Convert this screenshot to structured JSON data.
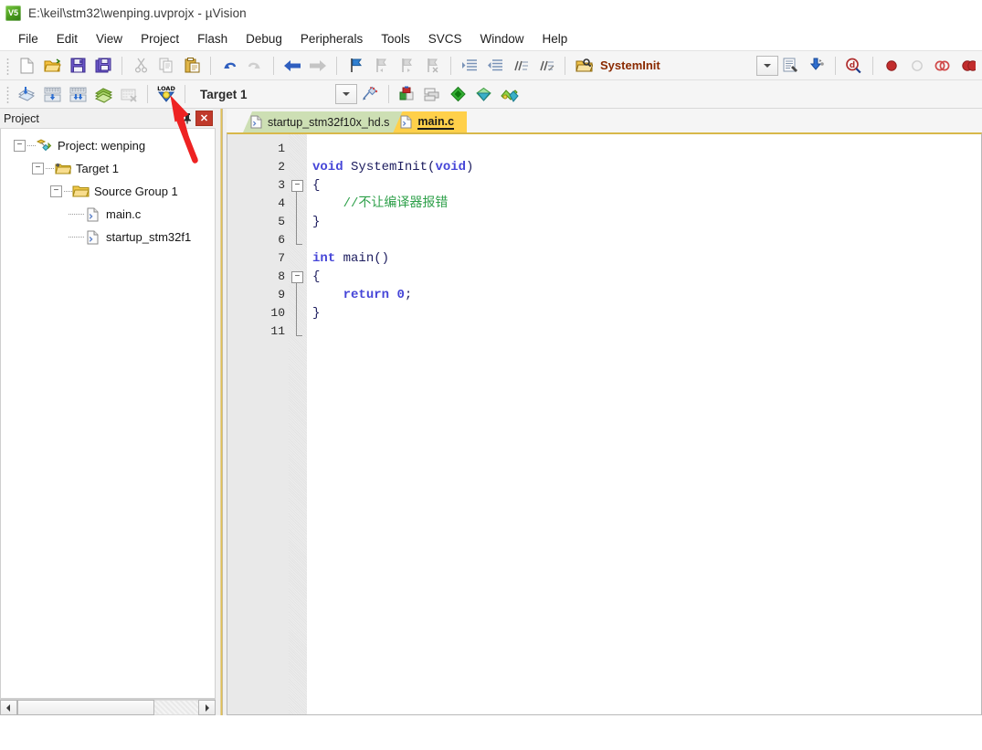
{
  "window": {
    "icon": "keil-uvision-icon",
    "icon_text": "V5",
    "title": "E:\\keil\\stm32\\wenping.uvprojx - µVision"
  },
  "menubar": {
    "items": [
      {
        "label": "File",
        "name": "menu-file"
      },
      {
        "label": "Edit",
        "name": "menu-edit"
      },
      {
        "label": "View",
        "name": "menu-view"
      },
      {
        "label": "Project",
        "name": "menu-project"
      },
      {
        "label": "Flash",
        "name": "menu-flash"
      },
      {
        "label": "Debug",
        "name": "menu-debug"
      },
      {
        "label": "Peripherals",
        "name": "menu-peripherals"
      },
      {
        "label": "Tools",
        "name": "menu-tools"
      },
      {
        "label": "SVCS",
        "name": "menu-svcs"
      },
      {
        "label": "Window",
        "name": "menu-window"
      },
      {
        "label": "Help",
        "name": "menu-help"
      }
    ]
  },
  "toolbar_main": {
    "buttons": [
      {
        "name": "new-file-icon",
        "title": "New"
      },
      {
        "name": "open-file-icon",
        "title": "Open"
      },
      {
        "name": "save-icon",
        "title": "Save"
      },
      {
        "name": "save-all-icon",
        "title": "Save All"
      },
      {
        "name": "cut-icon",
        "title": "Cut"
      },
      {
        "name": "copy-icon",
        "title": "Copy"
      },
      {
        "name": "paste-icon",
        "title": "Paste"
      },
      {
        "name": "undo-icon",
        "title": "Undo"
      },
      {
        "name": "redo-icon",
        "title": "Redo"
      },
      {
        "name": "navigate-back-icon",
        "title": "Back"
      },
      {
        "name": "navigate-forward-icon",
        "title": "Forward"
      },
      {
        "name": "bookmark-toggle-icon",
        "title": "Insert/Remove Bookmark"
      },
      {
        "name": "bookmark-prev-icon",
        "title": "Previous Bookmark"
      },
      {
        "name": "bookmark-next-icon",
        "title": "Next Bookmark"
      },
      {
        "name": "bookmark-clear-icon",
        "title": "Clear All Bookmarks"
      },
      {
        "name": "indent-increase-icon",
        "title": "Indent"
      },
      {
        "name": "indent-decrease-icon",
        "title": "Outdent"
      },
      {
        "name": "comment-icon",
        "title": "Comment"
      },
      {
        "name": "uncomment-icon",
        "title": "Uncomment"
      },
      {
        "name": "find-in-files-icon",
        "title": "Find in Files"
      }
    ],
    "function_label": "SystemInit",
    "right_buttons": [
      {
        "name": "function-combo-arrow-icon",
        "title": "Functions"
      },
      {
        "name": "text-select-icon",
        "title": "Configure"
      },
      {
        "name": "download-blue-icon",
        "title": "Download"
      },
      {
        "name": "find-icon",
        "title": "Find"
      },
      {
        "name": "breakpoint-insert-icon",
        "title": "Insert/Remove Breakpoint"
      },
      {
        "name": "breakpoint-disable-icon",
        "title": "Enable/Disable Breakpoint"
      },
      {
        "name": "breakpoint-disable-all-icon",
        "title": "Disable All Breakpoints"
      },
      {
        "name": "breakpoint-kill-all-icon",
        "title": "Kill All Breakpoints"
      }
    ]
  },
  "toolbar_build": {
    "buttons": [
      {
        "name": "translate-icon",
        "title": "Translate"
      },
      {
        "name": "build-icon",
        "title": "Build"
      },
      {
        "name": "rebuild-icon",
        "title": "Rebuild"
      },
      {
        "name": "batch-build-icon",
        "title": "Batch Build"
      },
      {
        "name": "stop-build-icon",
        "title": "Stop Build"
      },
      {
        "name": "download-load-icon",
        "title": "Download (LOAD)"
      }
    ],
    "target_value": "Target 1",
    "right_buttons": [
      {
        "name": "target-options-icon",
        "title": "Options for Target"
      },
      {
        "name": "manage-project-items-icon",
        "title": "Manage Project Items"
      },
      {
        "name": "pack-installer-icon",
        "title": "Pack Installer"
      },
      {
        "name": "run-time-environment-icon",
        "title": "Manage Run-Time Environment"
      },
      {
        "name": "multi-project-icon",
        "title": "Manage Multi-Project Workspace"
      }
    ]
  },
  "project_panel": {
    "title": "Project",
    "pin_icon": "pin-icon",
    "close_label": "✕",
    "tree": [
      {
        "label": "Project: wenping",
        "depth": 0,
        "icon": "project-icon",
        "expanded": true
      },
      {
        "label": "Target 1",
        "depth": 1,
        "icon": "target-icon",
        "expanded": true
      },
      {
        "label": "Source Group 1",
        "depth": 2,
        "icon": "folder-icon",
        "expanded": true
      },
      {
        "label": "main.c",
        "depth": 3,
        "icon": "c-file-icon",
        "expanded": null
      },
      {
        "label": "startup_stm32f1",
        "depth": 3,
        "icon": "asm-file-icon",
        "expanded": null
      }
    ]
  },
  "editor": {
    "tabs": [
      {
        "label": "startup_stm32f10x_hd.s",
        "active": false,
        "name": "tab-startup-stm32f10x-hd-s"
      },
      {
        "label": "main.c",
        "active": true,
        "name": "tab-main-c"
      }
    ],
    "line_numbers": [
      "1",
      "2",
      "3",
      "4",
      "5",
      "6",
      "7",
      "8",
      "9",
      "10",
      "11"
    ],
    "lines": [
      {
        "n": 1,
        "tokens": []
      },
      {
        "n": 2,
        "tokens": [
          {
            "t": "void",
            "c": "kw"
          },
          {
            "t": " ",
            "c": "punct"
          },
          {
            "t": "SystemInit",
            "c": "ident"
          },
          {
            "t": "(",
            "c": "punct"
          },
          {
            "t": "void",
            "c": "kw"
          },
          {
            "t": ")",
            "c": "punct"
          }
        ]
      },
      {
        "n": 3,
        "tokens": [
          {
            "t": "{",
            "c": "punct"
          }
        ]
      },
      {
        "n": 4,
        "tokens": [
          {
            "t": "    //不让编译器报错",
            "c": "cmt"
          }
        ]
      },
      {
        "n": 5,
        "tokens": [
          {
            "t": "}",
            "c": "punct"
          }
        ]
      },
      {
        "n": 6,
        "tokens": []
      },
      {
        "n": 7,
        "tokens": [
          {
            "t": "int",
            "c": "kw"
          },
          {
            "t": " ",
            "c": "punct"
          },
          {
            "t": "main",
            "c": "ident"
          },
          {
            "t": "()",
            "c": "punct"
          }
        ]
      },
      {
        "n": 8,
        "tokens": [
          {
            "t": "{",
            "c": "punct"
          }
        ]
      },
      {
        "n": 9,
        "tokens": [
          {
            "t": "    ",
            "c": "punct"
          },
          {
            "t": "return",
            "c": "kw"
          },
          {
            "t": " ",
            "c": "punct"
          },
          {
            "t": "0",
            "c": "num"
          },
          {
            "t": ";",
            "c": "punct"
          }
        ]
      },
      {
        "n": 10,
        "tokens": [
          {
            "t": "}",
            "c": "punct"
          }
        ]
      },
      {
        "n": 11,
        "tokens": []
      }
    ],
    "code_text": "\nvoid SystemInit(void)\n{\n    //不让编译器报错\n}\n\nint main()\n{\n    return 0;\n}\n"
  },
  "annotation": {
    "arrow_color": "#ee2222",
    "target": "download-load-icon",
    "name": "red-arrow-annotation"
  },
  "colors": {
    "tab_active": "#ffd04a",
    "tab_inactive": "#cddfb4",
    "keyword": "#4646d8",
    "identifier": "#1c1c5e",
    "comment": "#2ea04a",
    "gutter": "#e9e9e9",
    "splitter_accent": "#d8b84a",
    "close_button": "#c0392b"
  },
  "project_scrollbar": {
    "left_arrow": "◄",
    "right_arrow": "►"
  }
}
